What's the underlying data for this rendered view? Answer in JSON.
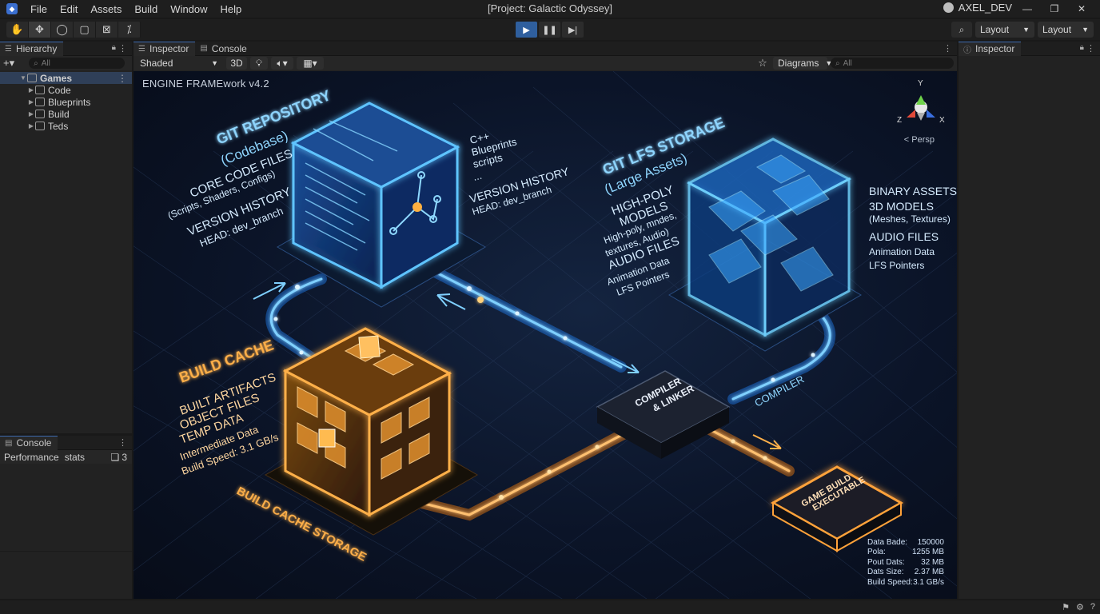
{
  "menubar": {
    "items": [
      "File",
      "Edit",
      "Assets",
      "Build",
      "Window",
      "Help"
    ],
    "window_title": "[Project: Galactic Odyssey]",
    "user": "AXEL_DEV"
  },
  "toolbar": {
    "tools": [
      "hand-icon",
      "move-icon",
      "rotate-icon",
      "rect-icon",
      "transform-icon",
      "custom-tool-icon"
    ],
    "layout_1": "Layout",
    "layout_2": "Layout"
  },
  "hierarchy": {
    "tab_label": "Hierarchy",
    "search_placeholder": "All",
    "root": "Games",
    "children": [
      "Code",
      "Blueprints",
      "Build",
      "Teds"
    ]
  },
  "console": {
    "tab_label": "Console",
    "col_performance": "Performance",
    "col_stats": "stats",
    "count": "3"
  },
  "center": {
    "tabs": [
      "Inspector",
      "Console"
    ],
    "shading": "Shaded",
    "mode_3d": "3D",
    "diagrams": "Diagrams",
    "search_placeholder": "All"
  },
  "right_panel": {
    "tab_label": "Inspector"
  },
  "scene": {
    "framework": "ENGINE FRAMEwork v4.2",
    "persp": "< Persp",
    "axes": {
      "x": "X",
      "y": "Y",
      "z": "Z"
    },
    "git": {
      "title": "GIT REPOSITORY",
      "subtitle": "(Codebase)",
      "core": "CORE CODE FILES",
      "core_sub": "(Scripts, Shaders, Configs)",
      "history": "VERSION HISTORY",
      "head": "HEAD: dev_branch",
      "bullets": [
        "C++",
        "Blueprints",
        "scripts",
        "..."
      ],
      "right_history": "VERSION HISTORY",
      "right_head": "HEAD: dev_branch"
    },
    "lfs": {
      "title": "GIT LFS STORAGE",
      "subtitle": "(Large Assets)",
      "left_1": "HIGH-POLY",
      "left_2": "MODELS",
      "left_3": "High-poly, mndes,",
      "left_4": "textures, Audio)",
      "left_5": "AUDIO FILES",
      "left_6": "Animation Data",
      "left_7": "LFS Pointers",
      "right_items": [
        "BINARY ASSETS",
        "3D MODELS",
        "(Meshes, Textures)",
        "AUDIO FILES",
        "Animation Data",
        "LFS Pointers"
      ]
    },
    "cache": {
      "title": "BUILD CACHE",
      "lines": [
        "BUILT ARTIFACTS",
        "OBJECT FILES",
        "TEMP DATA",
        "Intermediate Data",
        "Build Speed: 3.1 GB/s"
      ],
      "storage": "BUILD CACHE STORAGE"
    },
    "compiler": {
      "line1": "COMPILER",
      "line2": "& LINKER",
      "arrow_label": "COMPILER"
    },
    "game": {
      "line1": "GAME BUILD",
      "line2": "EXECUTABLE"
    },
    "stats": [
      {
        "label": "Data Bade:",
        "value": "150000"
      },
      {
        "label": "Pola:",
        "value": "1255 MB"
      },
      {
        "label": "Pout Dats:",
        "value": "32 MB"
      },
      {
        "label": "Dats Size:",
        "value": "2.37 MB"
      },
      {
        "label": "Build Speed:",
        "value": "3.1 GB/s"
      }
    ]
  },
  "colors": {
    "accent_blue": "#3fa9ff",
    "accent_orange": "#ffa23a",
    "play_active": "#2f5f9e"
  }
}
